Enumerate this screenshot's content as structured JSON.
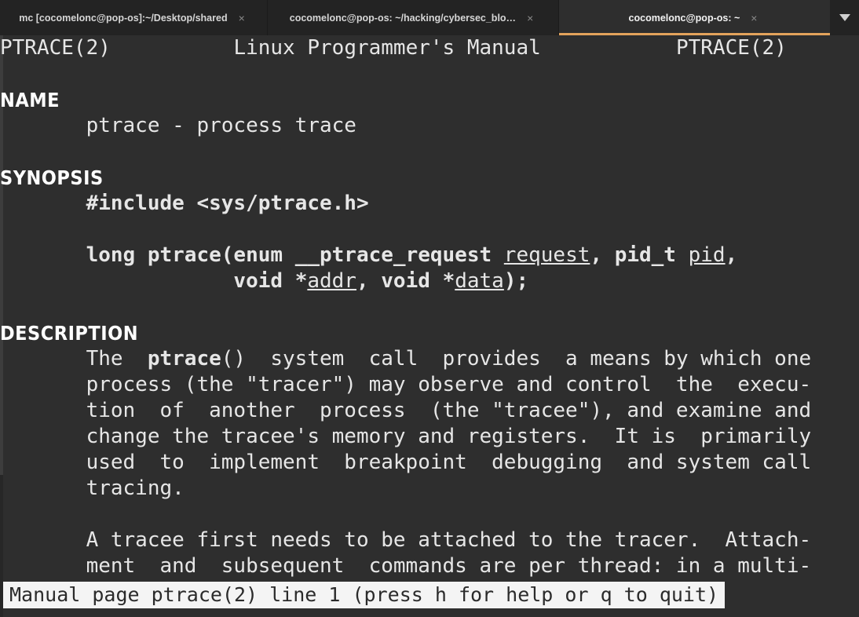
{
  "window": {
    "type": "terminal-emulator",
    "background_color": "#2e2e2e",
    "tabbar_color": "#232323",
    "accent_color": "#e3a35c",
    "foreground_color": "#e6e6e6"
  },
  "tabs": [
    {
      "label": "mc [cocomelonc@pop-os]:~/Desktop/shared",
      "close_label": "×",
      "active": false
    },
    {
      "label": "cocomelonc@pop-os: ~/hacking/cybersec_blo…",
      "close_label": "×",
      "active": false
    },
    {
      "label": "cocomelonc@pop-os: ~",
      "close_label": "×",
      "active": true
    }
  ],
  "tab_menu": {
    "icon": "chevron-down-icon"
  },
  "manpage": {
    "header": {
      "left": "PTRACE(2)",
      "center": "Linux Programmer's Manual",
      "right": "PTRACE(2)"
    },
    "sections": [
      {
        "title": "NAME",
        "lines": [
          [
            {
              "t": "       ptrace - process trace"
            }
          ]
        ]
      },
      {
        "title": "SYNOPSIS",
        "lines": [
          [
            {
              "t": "       #include <sys/ptrace.h>",
              "s": "b"
            }
          ],
          [
            {
              "t": ""
            }
          ],
          [
            {
              "t": "       long ptrace(",
              "s": "b"
            },
            {
              "t": "enum __ptrace_request ",
              "s": "b"
            },
            {
              "t": "request",
              "s": "u"
            },
            {
              "t": ", ",
              "s": "b"
            },
            {
              "t": "pid_t ",
              "s": "b"
            },
            {
              "t": "pid",
              "s": "u"
            },
            {
              "t": ",",
              "s": "b"
            }
          ],
          [
            {
              "t": "                   void ",
              "s": "b"
            },
            {
              "t": "*",
              "s": "b"
            },
            {
              "t": "addr",
              "s": "u"
            },
            {
              "t": ", ",
              "s": "b"
            },
            {
              "t": "void ",
              "s": "b"
            },
            {
              "t": "*",
              "s": "b"
            },
            {
              "t": "data",
              "s": "u"
            },
            {
              "t": ");",
              "s": "b"
            }
          ]
        ]
      },
      {
        "title": "DESCRIPTION",
        "lines": [
          [
            {
              "t": "       The  "
            },
            {
              "t": "ptrace",
              "s": "b"
            },
            {
              "t": "()  system  call  provides  a means by which one"
            }
          ],
          [
            {
              "t": "       process (the \"tracer\") may observe and control  the  execu-"
            }
          ],
          [
            {
              "t": "       tion  of  another  process  (the \"tracee\"), and examine and"
            }
          ],
          [
            {
              "t": "       change the tracee's memory and registers.  It is  primarily"
            }
          ],
          [
            {
              "t": "       used  to  implement  breakpoint  debugging  and system call"
            }
          ],
          [
            {
              "t": "       tracing."
            }
          ],
          [
            {
              "t": ""
            }
          ],
          [
            {
              "t": "       A tracee first needs to be attached to the tracer.  Attach-"
            }
          ],
          [
            {
              "t": "       ment  and  subsequent  commands are per thread: in a multi-"
            }
          ]
        ]
      }
    ]
  },
  "statusline": {
    "text": "Manual page ptrace(2) line 1 (press h for help or q to quit)"
  }
}
